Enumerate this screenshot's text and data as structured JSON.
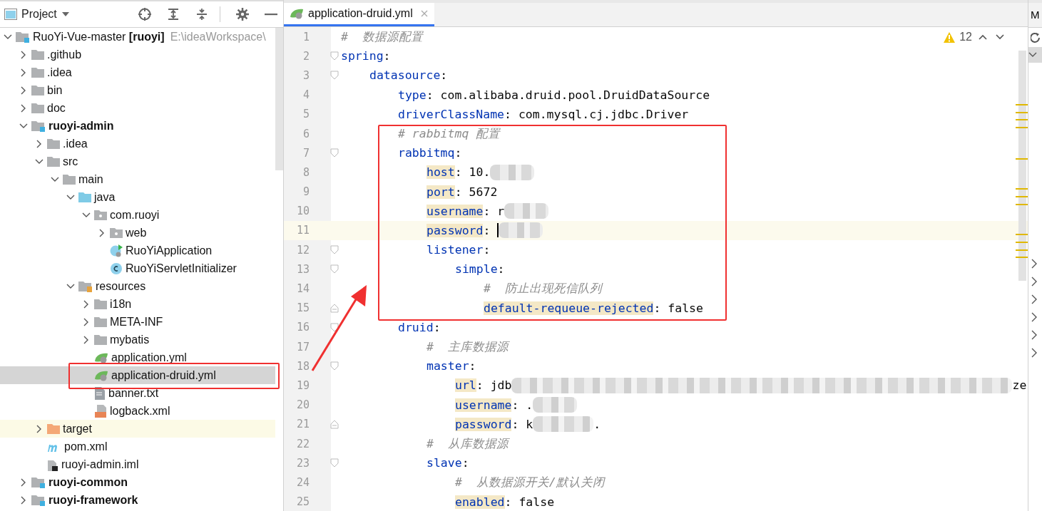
{
  "project_panel": {
    "title": "Project",
    "tree": [
      {
        "label": "RuoYi-Vue-master **[ruoyi]**",
        "path": "E:\\ideaWorkspace\\",
        "kind": "module",
        "bold": false,
        "expanded": true,
        "selected": false,
        "children": [
          {
            "label": ".github",
            "kind": "folder",
            "expanded": false,
            "selected": false
          },
          {
            "label": ".idea",
            "kind": "folder",
            "expanded": false,
            "selected": false
          },
          {
            "label": "bin",
            "kind": "folder",
            "expanded": false,
            "selected": false
          },
          {
            "label": "doc",
            "kind": "folder",
            "expanded": false,
            "selected": false
          },
          {
            "label": "ruoyi-admin",
            "kind": "module",
            "bold": true,
            "expanded": true,
            "selected": false,
            "children": [
              {
                "label": ".idea",
                "kind": "folder",
                "expanded": false,
                "selected": false
              },
              {
                "label": "src",
                "kind": "folder",
                "expanded": true,
                "selected": false,
                "children": [
                  {
                    "label": "main",
                    "kind": "folder",
                    "expanded": true,
                    "selected": false,
                    "children": [
                      {
                        "label": "java",
                        "kind": "source",
                        "expanded": true,
                        "selected": false,
                        "children": [
                          {
                            "label": "com.ruoyi",
                            "kind": "package",
                            "expanded": true,
                            "selected": false,
                            "children": [
                              {
                                "label": "web",
                                "kind": "package",
                                "expanded": false,
                                "selected": false
                              },
                              {
                                "label": "RuoYiApplication",
                                "kind": "run-class",
                                "selected": false
                              },
                              {
                                "label": "RuoYiServletInitializer",
                                "kind": "class",
                                "selected": false
                              }
                            ]
                          }
                        ]
                      },
                      {
                        "label": "resources",
                        "kind": "resources",
                        "expanded": true,
                        "selected": false,
                        "children": [
                          {
                            "label": "i18n",
                            "kind": "folder",
                            "expanded": false,
                            "selected": false
                          },
                          {
                            "label": "META-INF",
                            "kind": "folder",
                            "expanded": false,
                            "selected": false
                          },
                          {
                            "label": "mybatis",
                            "kind": "folder",
                            "expanded": false,
                            "selected": false
                          },
                          {
                            "label": "application.yml",
                            "kind": "spring",
                            "selected": false
                          },
                          {
                            "label": "application-druid.yml",
                            "kind": "spring",
                            "selected": true
                          },
                          {
                            "label": "banner.txt",
                            "kind": "text",
                            "selected": false
                          },
                          {
                            "label": "logback.xml",
                            "kind": "xml",
                            "selected": false
                          }
                        ]
                      }
                    ]
                  }
                ]
              },
              {
                "label": "target",
                "kind": "excluded",
                "expanded": false,
                "selected": false,
                "excluded": true
              },
              {
                "label": "pom.xml",
                "kind": "maven",
                "selected": false
              },
              {
                "label": "ruoyi-admin.iml",
                "kind": "iml",
                "selected": false
              }
            ]
          },
          {
            "label": "ruoyi-common",
            "kind": "module",
            "bold": true,
            "expanded": false,
            "selected": false
          },
          {
            "label": "ruoyi-framework",
            "kind": "module",
            "bold": true,
            "expanded": false,
            "selected": false
          }
        ]
      }
    ]
  },
  "editor": {
    "tabs": [
      {
        "label": "application-druid.yml",
        "selected": true
      }
    ],
    "warnings": "12",
    "lines": [
      {
        "number": "1",
        "current": false,
        "tokens": [
          {
            "kind": "comment",
            "text": "#  数据源配置"
          }
        ]
      },
      {
        "number": "2",
        "current": false,
        "tokens": [
          {
            "kind": "key",
            "text": "spring",
            "marked": false
          },
          {
            "kind": "punct",
            "text": ":"
          }
        ],
        "children": [
          {
            "number": "3",
            "current": false,
            "tokens": [
              {
                "kind": "key",
                "text": "datasource",
                "marked": false
              },
              {
                "kind": "punct",
                "text": ":"
              }
            ],
            "children": [
              {
                "number": "4",
                "current": false,
                "tokens": [
                  {
                    "kind": "key",
                    "text": "type",
                    "marked": false
                  },
                  {
                    "kind": "punct",
                    "text": ":"
                  },
                  {
                    "kind": "value",
                    "text": "com.alibaba.druid.pool.DruidDataSource"
                  }
                ]
              },
              {
                "number": "5",
                "current": false,
                "tokens": [
                  {
                    "kind": "key",
                    "text": "driverClassName",
                    "marked": false
                  },
                  {
                    "kind": "punct",
                    "text": ":"
                  },
                  {
                    "kind": "value",
                    "text": "com.mysql.cj.jdbc.Driver"
                  }
                ]
              },
              {
                "number": "6",
                "current": false,
                "tokens": [
                  {
                    "kind": "comment",
                    "text": "# rabbitmq 配置"
                  }
                ]
              },
              {
                "number": "7",
                "current": false,
                "tokens": [
                  {
                    "kind": "key",
                    "text": "rabbitmq",
                    "marked": false
                  },
                  {
                    "kind": "punct",
                    "text": ":"
                  }
                ],
                "children": [
                  {
                    "number": "8",
                    "current": false,
                    "tokens": [
                      {
                        "kind": "key",
                        "text": "host",
                        "marked": true
                      },
                      {
                        "kind": "punct",
                        "text": ":"
                      },
                      {
                        "kind": "value",
                        "text": "10."
                      },
                      {
                        "kind": "blur"
                      }
                    ]
                  },
                  {
                    "number": "9",
                    "current": false,
                    "tokens": [
                      {
                        "kind": "key",
                        "text": "port",
                        "marked": true
                      },
                      {
                        "kind": "punct",
                        "text": ":"
                      },
                      {
                        "kind": "value",
                        "text": "5672"
                      }
                    ]
                  },
                  {
                    "number": "10",
                    "current": false,
                    "tokens": [
                      {
                        "kind": "key",
                        "text": "username",
                        "marked": true
                      },
                      {
                        "kind": "punct",
                        "text": ":"
                      },
                      {
                        "kind": "value",
                        "text": "r"
                      },
                      {
                        "kind": "blur"
                      }
                    ]
                  },
                  {
                    "number": "11",
                    "current": true,
                    "tokens": [
                      {
                        "kind": "key",
                        "text": "password",
                        "marked": true
                      },
                      {
                        "kind": "punct",
                        "text": ":"
                      },
                      {
                        "kind": "caret"
                      },
                      {
                        "kind": "blur"
                      }
                    ]
                  },
                  {
                    "number": "12",
                    "current": false,
                    "tokens": [
                      {
                        "kind": "key",
                        "text": "listener",
                        "marked": false
                      },
                      {
                        "kind": "punct",
                        "text": ":"
                      }
                    ],
                    "children": [
                      {
                        "number": "13",
                        "current": false,
                        "tokens": [
                          {
                            "kind": "key",
                            "text": "simple",
                            "marked": false
                          },
                          {
                            "kind": "punct",
                            "text": ":"
                          }
                        ],
                        "children": [
                          {
                            "number": "14",
                            "current": false,
                            "tokens": [
                              {
                                "kind": "comment",
                                "text": "#  防止出现死信队列"
                              }
                            ]
                          },
                          {
                            "number": "15",
                            "current": false,
                            "tokens": [
                              {
                                "kind": "key",
                                "text": "default-requeue-rejected",
                                "marked": true
                              },
                              {
                                "kind": "punct",
                                "text": ":"
                              },
                              {
                                "kind": "value",
                                "text": "false"
                              }
                            ]
                          }
                        ]
                      }
                    ]
                  }
                ]
              },
              {
                "number": "16",
                "current": false,
                "tokens": [
                  {
                    "kind": "key",
                    "text": "druid",
                    "marked": false
                  },
                  {
                    "kind": "punct",
                    "text": ":"
                  }
                ],
                "children": [
                  {
                    "number": "17",
                    "current": false,
                    "tokens": [
                      {
                        "kind": "comment",
                        "text": "#  主库数据源"
                      }
                    ]
                  },
                  {
                    "number": "18",
                    "current": false,
                    "tokens": [
                      {
                        "kind": "key",
                        "text": "master",
                        "marked": false
                      },
                      {
                        "kind": "punct",
                        "text": ":"
                      }
                    ],
                    "children": [
                      {
                        "number": "19",
                        "current": false,
                        "tokens": [
                          {
                            "kind": "key",
                            "text": "url",
                            "marked": true
                          },
                          {
                            "kind": "punct",
                            "text": ":"
                          },
                          {
                            "kind": "value",
                            "text": "jdb"
                          },
                          {
                            "kind": "blur-long"
                          },
                          {
                            "kind": "tail",
                            "text": "ze"
                          }
                        ]
                      },
                      {
                        "number": "20",
                        "current": false,
                        "tokens": [
                          {
                            "kind": "key",
                            "text": "username",
                            "marked": true
                          },
                          {
                            "kind": "punct",
                            "text": ":"
                          },
                          {
                            "kind": "value",
                            "text": "."
                          },
                          {
                            "kind": "blur"
                          }
                        ]
                      },
                      {
                        "number": "21",
                        "current": false,
                        "tokens": [
                          {
                            "kind": "key",
                            "text": "password",
                            "marked": true
                          },
                          {
                            "kind": "punct",
                            "text": ":"
                          },
                          {
                            "kind": "value",
                            "text": "k"
                          },
                          {
                            "kind": "blur-wide"
                          },
                          {
                            "kind": "tail",
                            "text": "."
                          }
                        ]
                      }
                    ]
                  },
                  {
                    "number": "22",
                    "current": false,
                    "tokens": [
                      {
                        "kind": "comment",
                        "text": "#  从库数据源"
                      }
                    ]
                  },
                  {
                    "number": "23",
                    "current": false,
                    "tokens": [
                      {
                        "kind": "key",
                        "text": "slave",
                        "marked": false
                      },
                      {
                        "kind": "punct",
                        "text": ":"
                      }
                    ],
                    "children": [
                      {
                        "number": "24",
                        "current": false,
                        "tokens": [
                          {
                            "kind": "comment",
                            "text": "#  从数据源开关/默认关闭"
                          }
                        ]
                      },
                      {
                        "number": "25",
                        "current": false,
                        "tokens": [
                          {
                            "kind": "key",
                            "text": "enabled",
                            "marked": true
                          },
                          {
                            "kind": "punct",
                            "text": ":"
                          },
                          {
                            "kind": "value",
                            "text": "false"
                          }
                        ]
                      }
                    ]
                  }
                ]
              }
            ]
          }
        ]
      }
    ]
  },
  "side_panel": {
    "title": "M"
  }
}
